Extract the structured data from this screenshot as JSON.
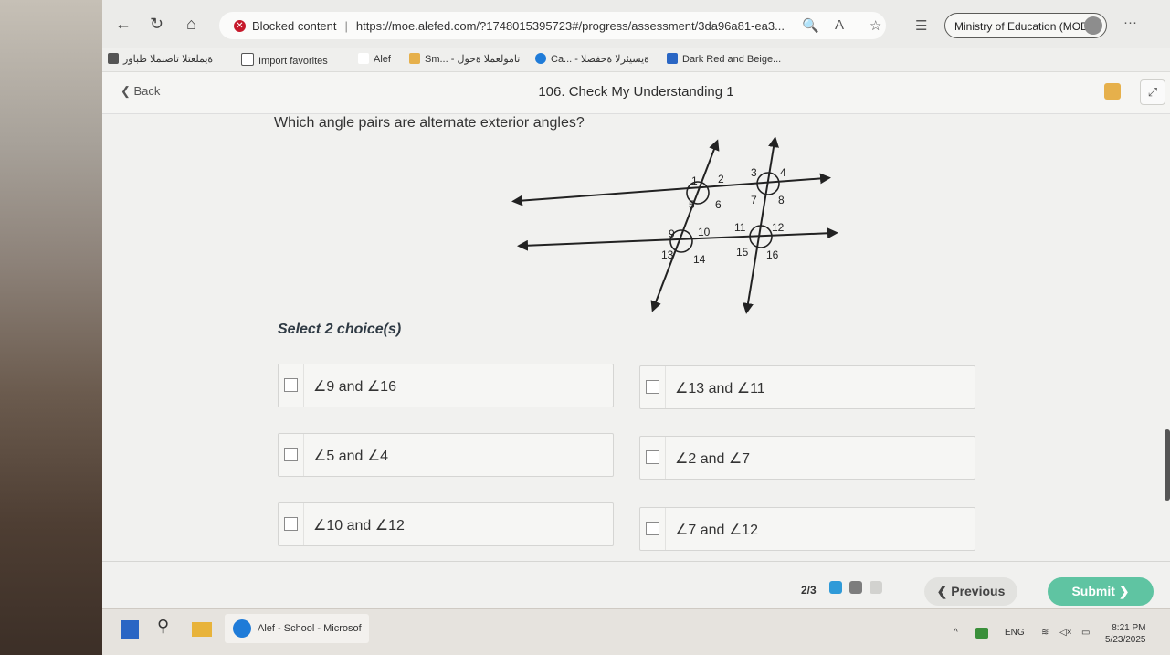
{
  "browser": {
    "blocked_label": "Blocked content",
    "url": "https://moe.alefed.com/?1748015395723#/progress/assessment/3da96a81-ea3...",
    "profile": "Ministry of Education (MOE)",
    "favorites": [
      "ةيملعتلا تاصنملا طباور",
      "Import favorites",
      "Alef",
      "Sm... - تامولعملا ةحول",
      "Ca... - ةيسيئرلا ةحفصلا",
      "Dark Red and Beige..."
    ]
  },
  "header": {
    "back_label": "Back",
    "title": "106. Check My Understanding 1"
  },
  "question": {
    "text": "Which angle pairs are alternate exterior angles?",
    "select_label": "Select 2 choice(s)"
  },
  "diagram": {
    "angle_labels": [
      "1",
      "2",
      "3",
      "4",
      "5",
      "6",
      "7",
      "8",
      "9",
      "10",
      "11",
      "12",
      "13",
      "14",
      "15",
      "16"
    ]
  },
  "choices": [
    {
      "label": "∠9  and  ∠16",
      "checked": false
    },
    {
      "label": "∠13  and  ∠11",
      "checked": false
    },
    {
      "label": "∠5  and  ∠4",
      "checked": false
    },
    {
      "label": "∠2  and  ∠7",
      "checked": false
    },
    {
      "label": "∠10  and  ∠12",
      "checked": false
    },
    {
      "label": "∠7  and  ∠12",
      "checked": false
    }
  ],
  "footer": {
    "progress": "2/3",
    "previous_label": "Previous",
    "submit_label": "Submit"
  },
  "taskbar": {
    "app_label": "Alef - School - Microsof",
    "lang": "ENG",
    "time": "8:21 PM",
    "date": "5/23/2025"
  },
  "colors": {
    "submit": "#5fc4a2",
    "blocked": "#c6192b",
    "done_square": "#2f9ad8"
  }
}
